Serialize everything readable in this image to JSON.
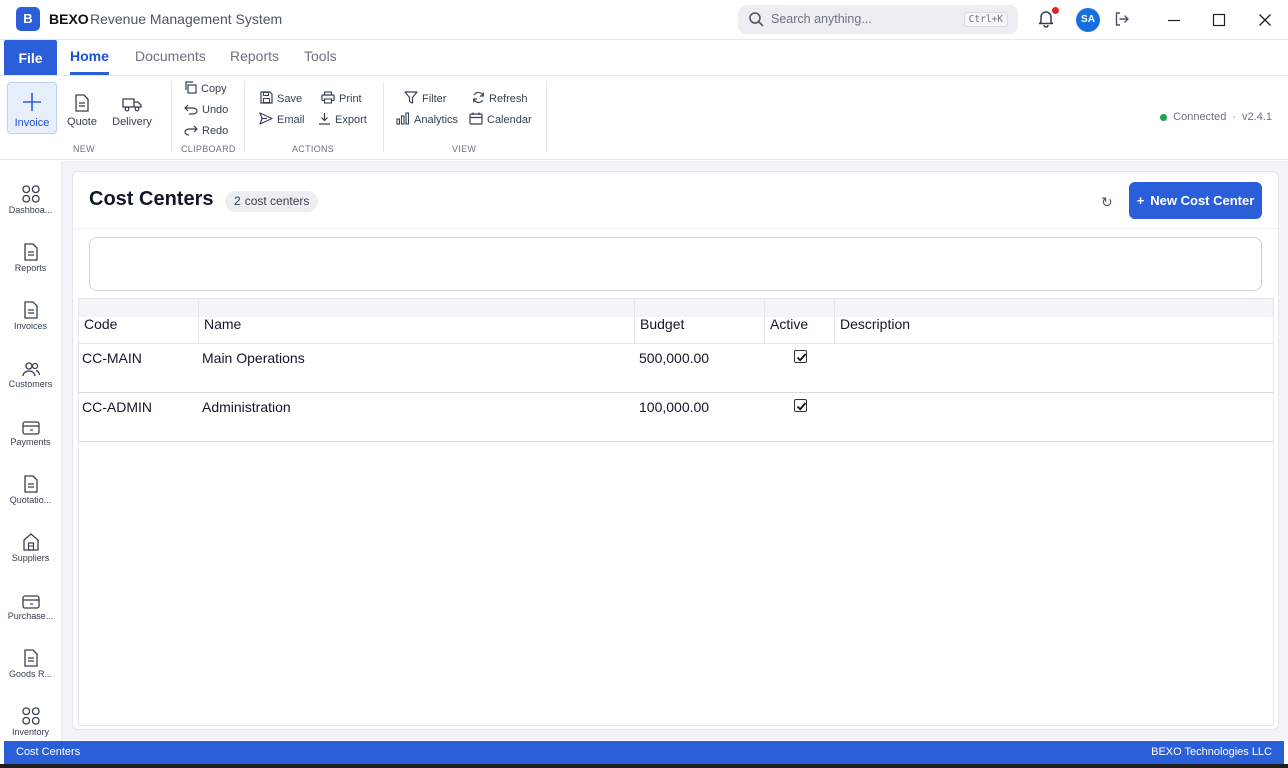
{
  "app": {
    "logo": "B",
    "name": "BEXO",
    "subtitle": "Revenue Management System"
  },
  "search": {
    "placeholder": "Search anything...",
    "shortcut": "Ctrl+K"
  },
  "user": {
    "initials": "SA"
  },
  "menu": {
    "file": "File",
    "tabs": [
      "Home",
      "Documents",
      "Reports",
      "Tools"
    ],
    "active_tab": "Home"
  },
  "ribbon": {
    "new": {
      "label": "NEW",
      "items": [
        "Invoice",
        "Quote",
        "Delivery"
      ]
    },
    "clipboard": {
      "label": "CLIPBOARD",
      "items": [
        "Copy",
        "Undo",
        "Redo"
      ]
    },
    "actions": {
      "label": "ACTIONS",
      "items": [
        "Save",
        "Print",
        "Email",
        "Export"
      ]
    },
    "view": {
      "label": "VIEW",
      "items": [
        "Filter",
        "Refresh",
        "Analytics",
        "Calendar"
      ]
    },
    "status": {
      "text": "Connected",
      "version": "v2.4.1",
      "separator": "·",
      "color": "#16a34a"
    }
  },
  "sidebar": {
    "items": [
      "Dashboa...",
      "Reports",
      "Invoices",
      "Customers",
      "Payments",
      "Quotatio...",
      "Suppliers",
      "Purchase...",
      "Goods R...",
      "Inventory"
    ]
  },
  "page": {
    "title": "Cost Centers",
    "count": "2",
    "count_label": "cost centers",
    "new_button": "New Cost Center",
    "new_button_prefix": "+",
    "refresh_glyph": "↻"
  },
  "table": {
    "columns": [
      "Code",
      "Name",
      "Budget",
      "Active",
      "Description"
    ],
    "rows": [
      {
        "code": "CC-MAIN",
        "name": "Main Operations",
        "budget": "500,000.00",
        "active": true,
        "description": ""
      },
      {
        "code": "CC-ADMIN",
        "name": "Administration",
        "budget": "100,000.00",
        "active": true,
        "description": ""
      }
    ]
  },
  "statusbar": {
    "left": "Cost Centers",
    "right": "BEXO Technologies LLC"
  },
  "colors": {
    "accent": "#2b5fd9",
    "notification": "#e02424",
    "avatar": "#1a6fe0"
  }
}
